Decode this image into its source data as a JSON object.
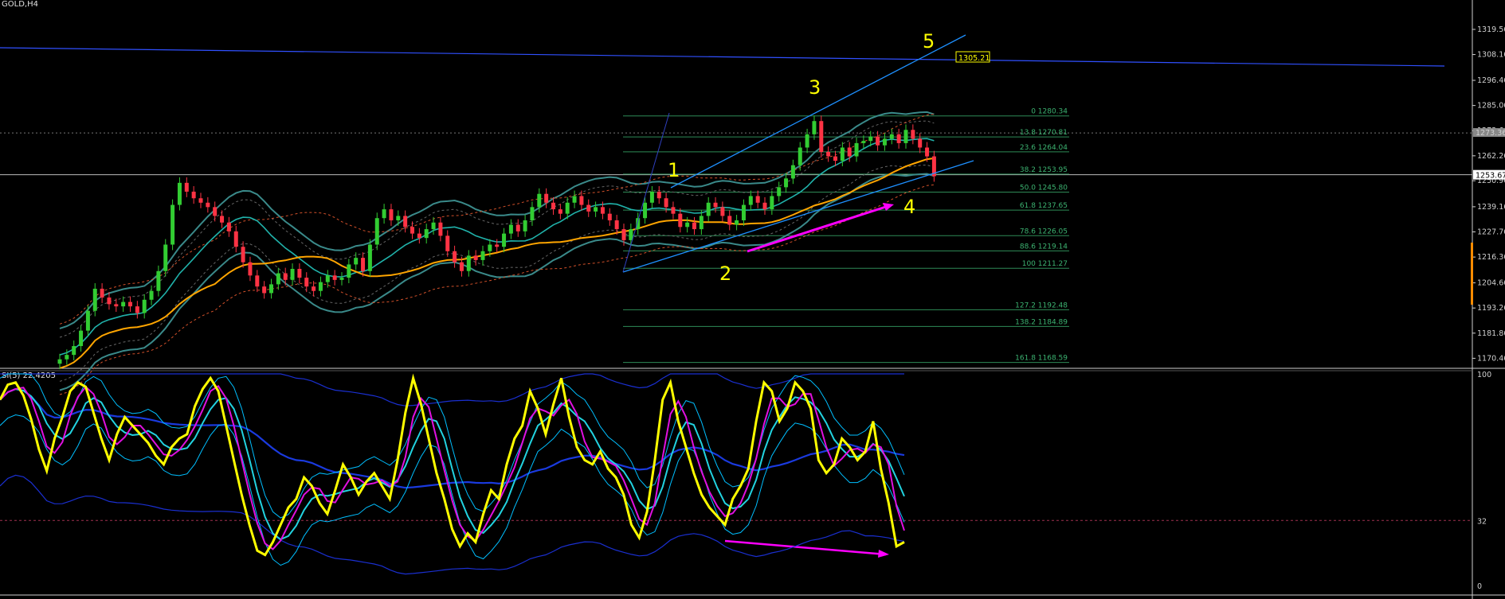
{
  "window": {
    "symbol_title": "GOLD,H4"
  },
  "indicator": {
    "title": "SI(5) 22.4205",
    "levels": [
      100,
      32,
      0
    ],
    "level_labels": [
      "100",
      "32",
      "0"
    ]
  },
  "colors": {
    "background": "#000000",
    "bull": "#32cd32",
    "bear": "#ff3344",
    "wave": "#ffff00",
    "fib": "#2e8b57",
    "trend": "#1e90ff",
    "ema": "#ffa500",
    "envelope": "#20b2aa",
    "resistance": "#3050ff",
    "divergence": "#ff00ff"
  },
  "chart_data": {
    "type": "candlestick",
    "price_axis": {
      "ticks": [
        "1319.56",
        "1308.16",
        "1296.46",
        "1285.06",
        "1273.66",
        "1262.26",
        "1250.96",
        "1239.16",
        "1227.76",
        "1216.36",
        "1204.66",
        "1193.26",
        "1181.86",
        "1170.46"
      ],
      "ylim": [
        1167,
        1330
      ]
    },
    "price_markers": {
      "current": "1253.67",
      "upper": "1273.36",
      "target": "1305.21"
    },
    "fibonacci": [
      {
        "label": "0 1280.34",
        "price": 1280.34
      },
      {
        "label": "13.8 1270.81",
        "price": 1270.81
      },
      {
        "label": "23.6 1264.04",
        "price": 1264.04
      },
      {
        "label": "38.2 1253.95",
        "price": 1253.95
      },
      {
        "label": "50.0 1245.80",
        "price": 1245.8
      },
      {
        "label": "61.8 1237.65",
        "price": 1237.65
      },
      {
        "label": "78.6 1226.05",
        "price": 1226.05
      },
      {
        "label": "88.6 1219.14",
        "price": 1219.14
      },
      {
        "label": "100 1211.27",
        "price": 1211.27
      },
      {
        "label": "127.2 1192.48",
        "price": 1192.48
      },
      {
        "label": "138.2 1184.89",
        "price": 1184.89
      },
      {
        "label": "161.8 1168.59",
        "price": 1168.59
      }
    ],
    "wave_labels": [
      "1",
      "2",
      "3",
      "4",
      "5"
    ],
    "close_series": [
      1170,
      1172,
      1176,
      1183,
      1192,
      1202,
      1198,
      1195,
      1194,
      1196,
      1194,
      1191,
      1197,
      1201,
      1210,
      1222,
      1240,
      1250,
      1246,
      1243,
      1241,
      1239,
      1235,
      1232,
      1228,
      1221,
      1214,
      1208,
      1203,
      1200,
      1204,
      1209,
      1206,
      1211,
      1207,
      1203,
      1201,
      1205,
      1208,
      1206,
      1207,
      1213,
      1216,
      1210,
      1222,
      1234,
      1238,
      1233,
      1235,
      1230,
      1227,
      1225,
      1229,
      1232,
      1226,
      1219,
      1214,
      1210,
      1217,
      1215,
      1219,
      1222,
      1221,
      1227,
      1231,
      1228,
      1233,
      1239,
      1245,
      1241,
      1238,
      1236,
      1241,
      1244,
      1240,
      1237,
      1239,
      1236,
      1233,
      1229,
      1224,
      1229,
      1234,
      1241,
      1246,
      1243,
      1239,
      1236,
      1230,
      1232,
      1229,
      1235,
      1241,
      1239,
      1235,
      1231,
      1233,
      1240,
      1244,
      1241,
      1238,
      1244,
      1248,
      1252,
      1258,
      1266,
      1272,
      1278,
      1264,
      1262,
      1260,
      1266,
      1262,
      1268,
      1269,
      1271,
      1267,
      1270,
      1272,
      1268,
      1274,
      1270,
      1266,
      1262,
      1253
    ],
    "stoch_main": [
      88,
      95,
      96,
      90,
      79,
      65,
      55,
      70,
      80,
      92,
      96,
      94,
      82,
      70,
      60,
      72,
      80,
      76,
      72,
      68,
      62,
      58,
      66,
      70,
      72,
      85,
      93,
      98,
      92,
      76,
      60,
      44,
      30,
      18,
      16,
      22,
      30,
      38,
      42,
      52,
      48,
      40,
      35,
      46,
      58,
      52,
      44,
      50,
      54,
      48,
      42,
      60,
      82,
      98,
      86,
      70,
      54,
      42,
      28,
      20,
      26,
      22,
      35,
      46,
      42,
      58,
      70,
      76,
      92,
      84,
      72,
      86,
      98,
      80,
      66,
      60,
      58,
      64,
      56,
      52,
      44,
      30,
      24,
      36,
      60,
      88,
      96,
      78,
      66,
      54,
      44,
      38,
      34,
      30,
      42,
      48,
      56,
      78,
      96,
      92,
      78,
      84,
      96,
      92,
      84,
      60,
      54,
      58,
      70,
      66,
      60,
      64,
      78,
      56,
      40,
      20,
      22
    ]
  }
}
